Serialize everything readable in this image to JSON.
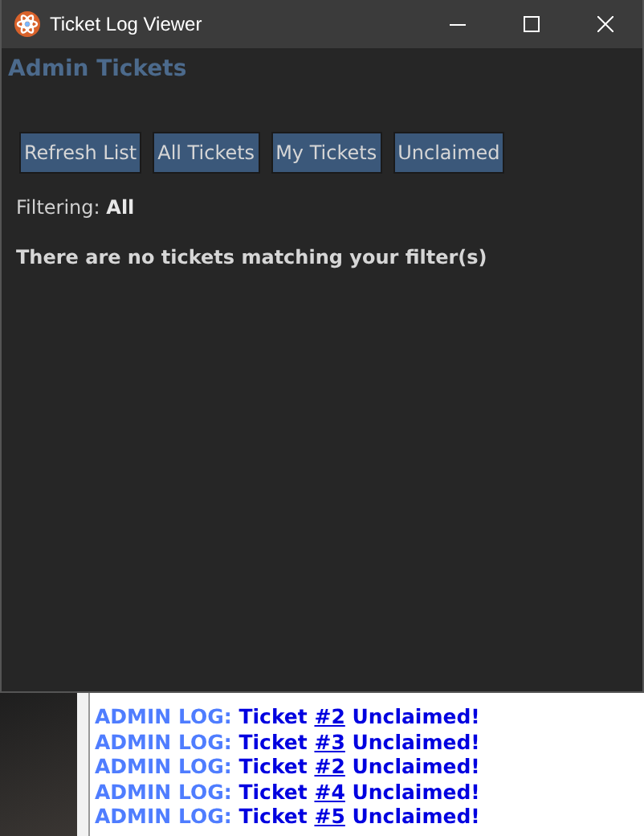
{
  "window": {
    "title": "Ticket Log Viewer"
  },
  "heading": "Admin Tickets",
  "buttons": [
    "Refresh List",
    "All Tickets",
    "My Tickets",
    "Unclaimed"
  ],
  "filter": {
    "label": "Filtering:",
    "value": "All"
  },
  "empty_message": "There are no tickets matching your filter(s)",
  "chat_log": [
    {
      "prefix": "ADMIN LOG:",
      "before": "Ticket",
      "link": "#2",
      "after": "Unclaimed!"
    },
    {
      "prefix": "ADMIN LOG:",
      "before": "Ticket",
      "link": "#3",
      "after": "Unclaimed!"
    },
    {
      "prefix": "ADMIN LOG:",
      "before": "Ticket",
      "link": "#2",
      "after": "Unclaimed!"
    },
    {
      "prefix": "ADMIN LOG:",
      "before": "Ticket",
      "link": "#4",
      "after": "Unclaimed!"
    },
    {
      "prefix": "ADMIN LOG:",
      "before": "Ticket",
      "link": "#5",
      "after": "Unclaimed!"
    }
  ]
}
